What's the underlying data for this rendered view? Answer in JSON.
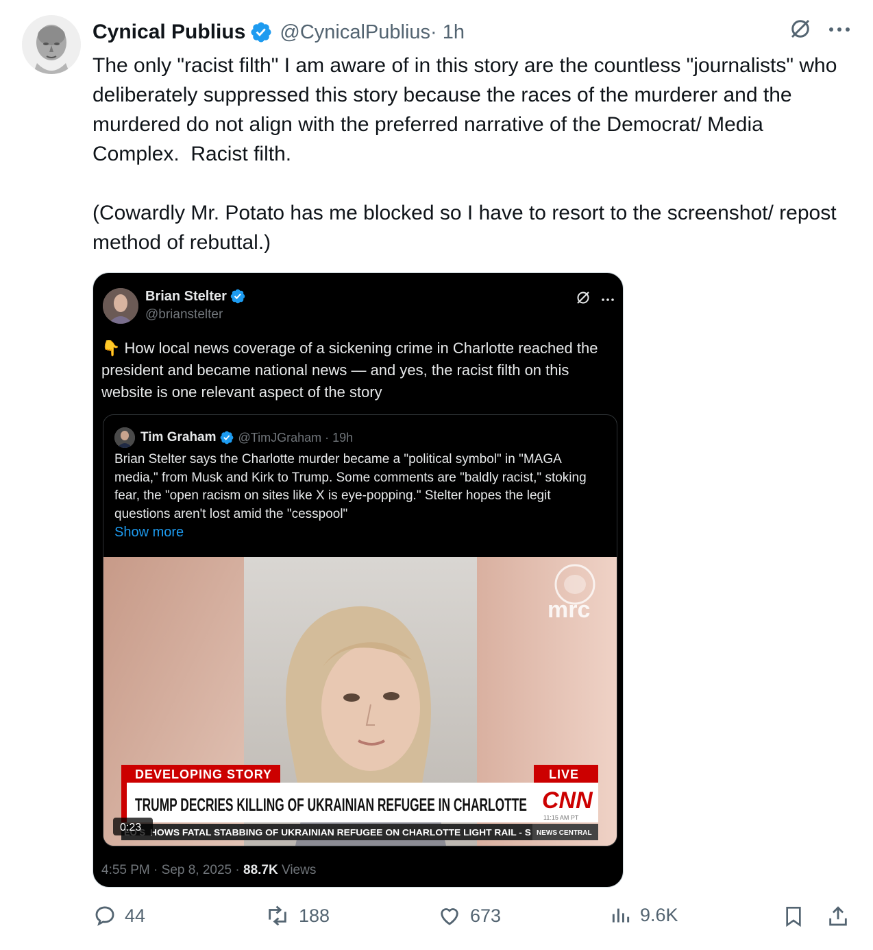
{
  "post": {
    "author_name": "Cynical Publius",
    "author_handle": "@CynicalPublius",
    "time": " · 1h",
    "text": "The only \"racist filth\" I am aware of in this story are the countless \"journalists\" who deliberately suppressed this story because the races of the murderer and the murdered do not align with the preferred narrative of the Democrat/ Media Complex.  Racist filth.\n\n(Cowardly Mr. Potato has me blocked so I have to resort to the screenshot/ repost method of rebuttal.)"
  },
  "embed": {
    "author_name": "Brian Stelter",
    "author_handle": "@brianstelter",
    "emoji": "👇",
    "text": "How local news coverage of a sickening crime in Charlotte reached the president and became national news — and yes, the racist filth on this website is one relevant aspect of the story",
    "quote": {
      "author_name": "Tim Graham",
      "author_handle": "@TimJGraham · 19h",
      "text": "Brian Stelter says the Charlotte murder became a \"political symbol\" in \"MAGA media,\" from Musk and Kirk to Trump. Some comments are \"baldly racist,\" stoking fear, the \"open racism on sites like X is eye-popping.\" Stelter hopes the legit questions aren't lost amid the \"cesspool\"",
      "show_more": "Show more"
    },
    "video": {
      "watermark": "mrc",
      "banner_top": "DEVELOPING STORY",
      "live": "LIVE",
      "headline": "TRUMP DECRIES KILLING OF UKRAINIAN REFUGEE IN CHARLOTTE",
      "network": "CNN",
      "timestamp": "11:15 AM PT",
      "ticker_prefix": "EO S",
      "ticker": "HOWS FATAL STABBING OF UKRAINIAN REFUGEE ON CHARLOTTE LIGHT RAIL - S",
      "ticker_tag": "NEWS CENTRAL",
      "duration": "0:23"
    },
    "timestamp": "4:55 PM · Sep 8, 2025 · ",
    "views_count": "88.7K",
    "views_label": " Views"
  },
  "actions": {
    "replies": "44",
    "reposts": "188",
    "likes": "673",
    "views": "9.6K"
  },
  "colors": {
    "verified": "#1d9bf0",
    "cnn_red": "#cc0000"
  },
  "icons": [
    "verified-badge-icon",
    "grok-icon",
    "more-icon",
    "reply-icon",
    "repost-icon",
    "like-icon",
    "views-icon",
    "bookmark-icon",
    "share-icon"
  ]
}
